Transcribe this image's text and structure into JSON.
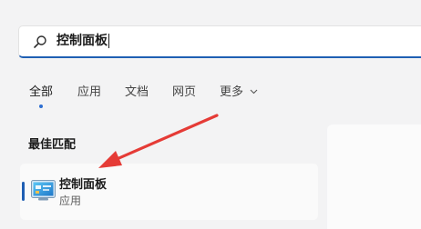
{
  "search": {
    "value": "控制面板"
  },
  "tabs": [
    {
      "label": "全部",
      "active": true
    },
    {
      "label": "应用"
    },
    {
      "label": "文档"
    },
    {
      "label": "网页"
    },
    {
      "label": "更多"
    }
  ],
  "best_match": {
    "section_title": "最佳匹配",
    "title": "控制面板",
    "subtitle": "应用",
    "icon": "control-panel-icon"
  },
  "colors": {
    "accent": "#1f5fb3",
    "annotation_arrow": "#e53b36"
  }
}
